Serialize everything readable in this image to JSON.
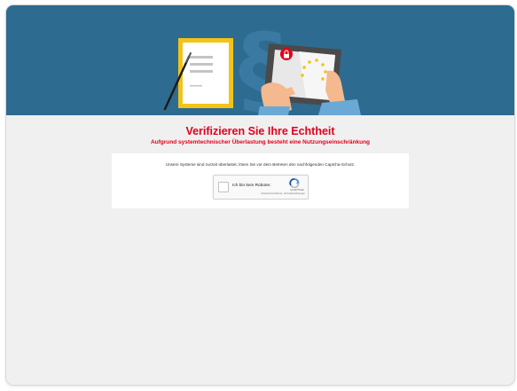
{
  "page": {
    "title": "Verifizieren Sie Ihre Echtheit",
    "subtitle": "Aufgrund systemtechnischer Überlastung besteht eine Nutzungseinschränkung"
  },
  "card": {
    "message": "Unsere Systeme sind zurzeit überlastet, lösen Sie vor dem Betreten den nachfolgenden Captcha-Schutz."
  },
  "captcha": {
    "checkbox_label": "Ich bin kein Roboter.",
    "brand": "reCAPTCHA",
    "privacy_link": "Datenschutzerklärung",
    "separator": " - ",
    "terms_link": "Nutzungsbedingungen",
    "checked": false
  },
  "colors": {
    "banner": "#2e6b90",
    "accent_red": "#e2001a",
    "background": "#f0f0f0",
    "doc_frame": "#f3c316"
  },
  "icons": {
    "document": "document-icon",
    "tablet": "tablet-icon",
    "lock": "lock-icon",
    "paragraph": "paragraph-icon",
    "recaptcha": "recaptcha-logo-icon"
  }
}
